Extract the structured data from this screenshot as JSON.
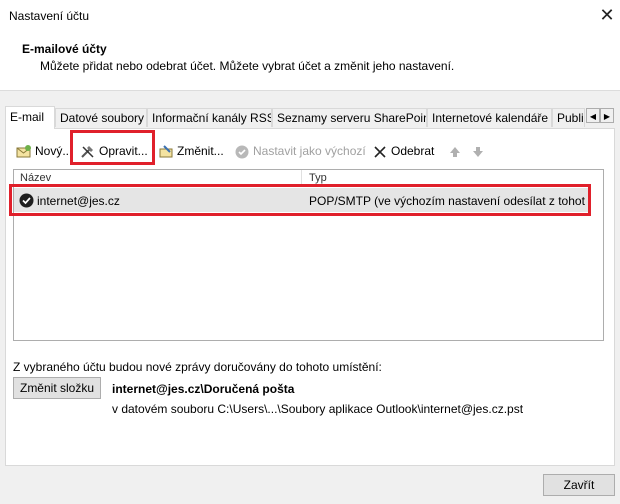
{
  "window": {
    "title": "Nastavení účtu",
    "close_glyph": "✕"
  },
  "header": {
    "title": "E-mailové účty",
    "subtitle": "Můžete přidat nebo odebrat účet. Můžete vybrat účet a změnit jeho nastavení."
  },
  "tabs": [
    "E-mail",
    "Datové soubory",
    "Informační kanály RSS",
    "Seznamy serveru SharePoint",
    "Internetové kalendáře",
    "Publi"
  ],
  "toolbar": {
    "new": "Nový...",
    "repair": "Opravit...",
    "change": "Změnit...",
    "set_default": "Nastavit jako výchozí",
    "remove": "Odebrat",
    "icons": {
      "new": "new-mail-icon",
      "repair": "tools-icon",
      "change": "change-icon",
      "set_default": "check-circle-icon",
      "remove": "x-icon",
      "up": "arrow-up-icon",
      "down": "arrow-down-icon"
    }
  },
  "list": {
    "columns": [
      "Název",
      "Typ"
    ],
    "rows": [
      {
        "name": "internet@jes.cz",
        "type": "POP/SMTP (ve výchozím nastavení odesílat z tohoto ..."
      }
    ]
  },
  "delivery": {
    "label": "Z vybraného účtu budou nové zprávy doručovány do tohoto umístění:",
    "change_folder": "Změnit složku",
    "destination": "internet@jes.cz\\Doručená pošta",
    "path": "v datovém souboru C:\\Users\\...\\Soubory aplikace Outlook\\internet@jes.cz.pst"
  },
  "footer": {
    "close": "Zavřít"
  },
  "colors": {
    "highlight_red": "#e0202b",
    "selected_row": "#e5e5e5"
  }
}
